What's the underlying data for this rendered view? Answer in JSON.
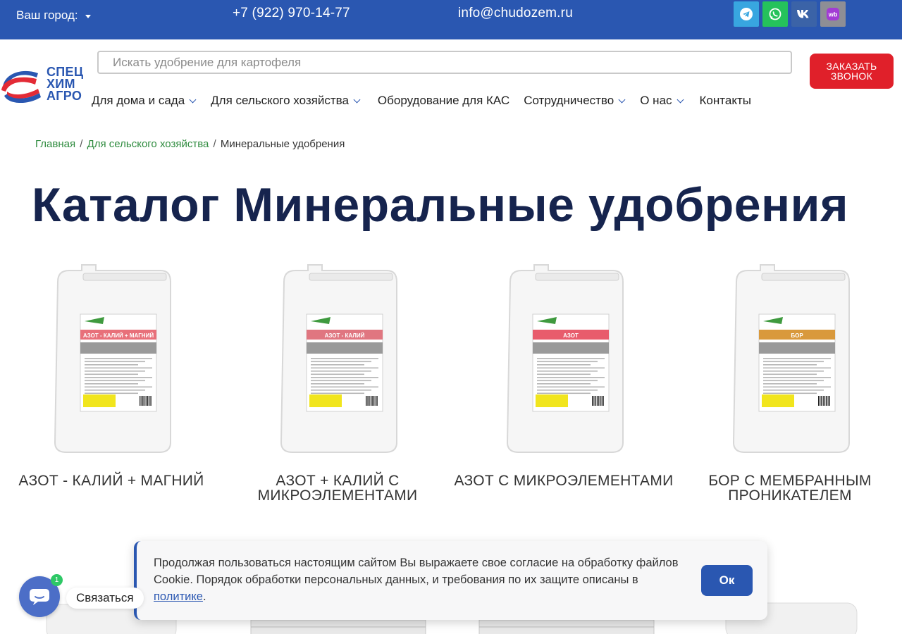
{
  "topbar": {
    "city_label": "Ваш город:",
    "phone": "+7 (922) 970-14-77",
    "email": "info@chudozem.ru",
    "socials": [
      "telegram-icon",
      "whatsapp-icon",
      "vk-icon",
      "wildberries-icon"
    ],
    "wb_text": "wb"
  },
  "header": {
    "logo_lines": [
      "СПЕЦ",
      "ХИМ",
      "АГРО"
    ],
    "search_placeholder": "Искать удобрение для картофеля",
    "order_button": [
      "ЗАКАЗАТЬ",
      "ЗВОНОК"
    ]
  },
  "nav": {
    "items": [
      {
        "label": "Для дома и сада",
        "dropdown": true
      },
      {
        "label": "Для сельского хозяйства",
        "dropdown": true
      },
      {
        "label": "Оборудование для КАС",
        "dropdown": false
      },
      {
        "label": "Сотрудничество",
        "dropdown": true
      },
      {
        "label": "О нас",
        "dropdown": true
      },
      {
        "label": "Контакты",
        "dropdown": false
      }
    ]
  },
  "breadcrumb": {
    "home": "Главная",
    "sep": "/",
    "section": "Для сельского хозяйства",
    "current": "Минеральные удобрения"
  },
  "page_title": "Каталог Минеральные удобрения",
  "products": [
    {
      "name": "АЗОТ - КАЛИЙ + МАГНИЙ",
      "label_title": "АЗОТ - КАЛИЙ + МАГНИЙ",
      "label_color": "#e8707a"
    },
    {
      "name": "АЗОТ + КАЛИЙ С МИКРОЭЛЕМЕНТАМИ",
      "label_title": "АЗОТ - КАЛИЙ",
      "label_color": "#e07680"
    },
    {
      "name": "АЗОТ С МИКРОЭЛЕМЕНТАМИ",
      "label_title": "АЗОТ",
      "label_color": "#e85c6c"
    },
    {
      "name": "БОР С МЕМБРАННЫМ ПРОНИКАТЕЛЕМ",
      "label_title": "БОР",
      "label_color": "#d9993c"
    }
  ],
  "cookie": {
    "text": "Продолжая пользоваться настоящим сайтом Вы выражаете свое согласие на обработку файлов Cookie. Порядок обработки персональных данных, и требования по их защите описаны в ",
    "link": "политике",
    "tail": ".",
    "ok": "Ок"
  },
  "chat": {
    "label": "Связаться",
    "badge": "1"
  },
  "colors": {
    "brand_blue": "#2a57b1",
    "accent_red": "#e0202a",
    "title_navy": "#16244e",
    "breadcrumb_green": "#2e8b3e"
  }
}
